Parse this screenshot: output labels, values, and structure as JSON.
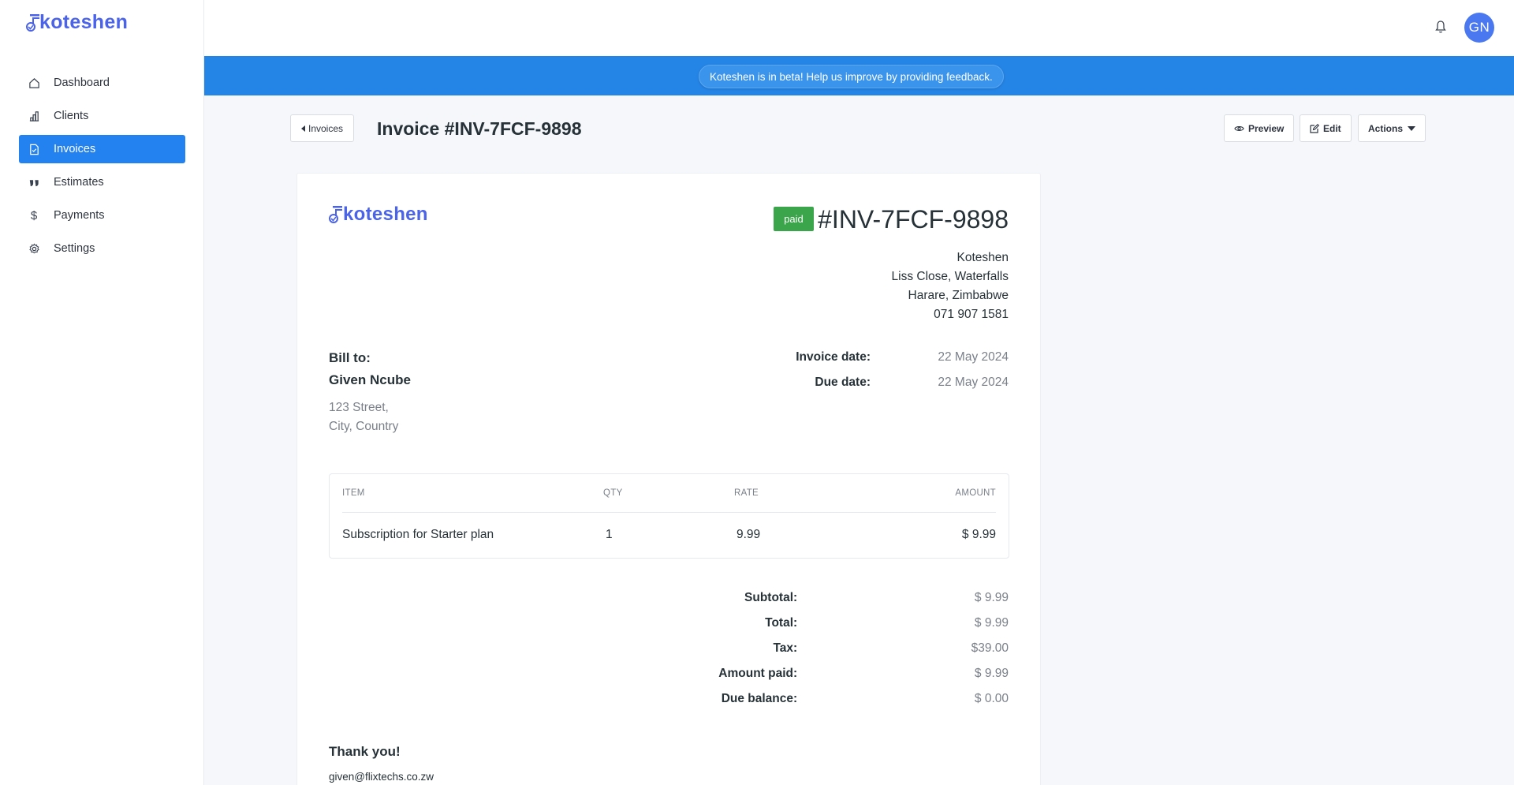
{
  "app": {
    "brand": "koteshen"
  },
  "sidebar": {
    "items": [
      {
        "label": "Dashboard",
        "icon": "home-icon"
      },
      {
        "label": "Clients",
        "icon": "chart-bar-icon"
      },
      {
        "label": "Invoices",
        "icon": "document-icon",
        "active": true
      },
      {
        "label": "Estimates",
        "icon": "quote-icon"
      },
      {
        "label": "Payments",
        "icon": "dollar-icon"
      },
      {
        "label": "Settings",
        "icon": "gear-icon"
      }
    ]
  },
  "topbar": {
    "avatar_initials": "GN"
  },
  "banner": {
    "text": "Koteshen is in beta! Help us improve by providing feedback."
  },
  "header": {
    "back_label": "Invoices",
    "title": "Invoice #INV-7FCF-9898",
    "preview_label": "Preview",
    "edit_label": "Edit",
    "actions_label": "Actions"
  },
  "invoice": {
    "status": "paid",
    "number": "#INV-7FCF-9898",
    "company": {
      "name": "Koteshen",
      "address1": "Liss Close, Waterfalls",
      "address2": "Harare, Zimbabwe",
      "phone": "071 907 1581"
    },
    "bill_to_label": "Bill to:",
    "client": {
      "name": "Given Ncube",
      "address1": "123 Street,",
      "address2": "City, Country"
    },
    "invoice_date_label": "Invoice date:",
    "invoice_date": "22 May 2024",
    "due_date_label": "Due date:",
    "due_date": "22 May 2024",
    "columns": {
      "item": "ITEM",
      "qty": "QTY",
      "rate": "RATE",
      "amount": "AMOUNT"
    },
    "line_items": [
      {
        "item": "Subscription for Starter plan",
        "qty": "1",
        "rate": "9.99",
        "amount": "$ 9.99"
      }
    ],
    "totals": {
      "subtotal_label": "Subtotal:",
      "subtotal": "$ 9.99",
      "total_label": "Total:",
      "total": "$ 9.99",
      "tax_label": "Tax:",
      "tax": "$39.00",
      "paid_label": "Amount paid:",
      "paid": "$ 9.99",
      "due_label": "Due balance:",
      "due": "$ 0.00"
    },
    "thanks": "Thank you!",
    "email": "given@flixtechs.co.zw"
  },
  "colors": {
    "accent": "#2382f0",
    "brand": "#4a63e8",
    "banner": "#2585e6",
    "paid": "#3aa54a"
  }
}
